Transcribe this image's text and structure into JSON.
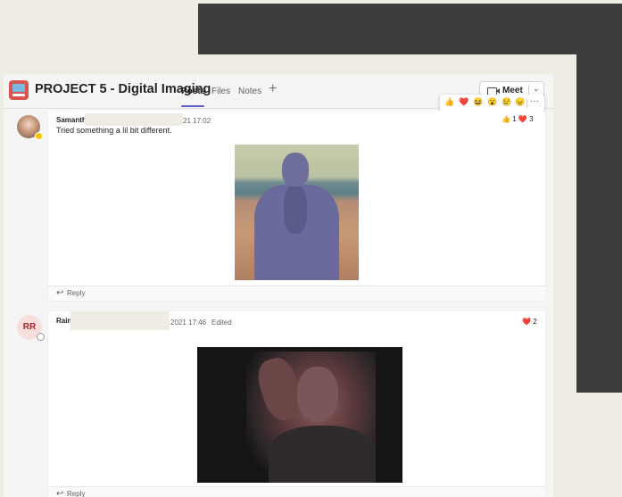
{
  "header": {
    "team_title": "PROJECT 5 - Digital Imaging",
    "tabs": [
      {
        "label": "Posts",
        "active": true
      },
      {
        "label": "Files",
        "active": false
      },
      {
        "label": "Notes",
        "active": false
      }
    ],
    "add_tab_glyph": "+",
    "meet_label": "Meet",
    "icons": [
      "team-icon",
      "video-camera-icon",
      "chevron-down-icon",
      "add-icon"
    ]
  },
  "reaction_picker": {
    "emojis": [
      "👍",
      "❤️",
      "😆",
      "😮",
      "😢",
      "😠"
    ],
    "more_glyph": "···"
  },
  "posts": [
    {
      "author_visible": "Samanth",
      "timestamp_visible": "21 17:02",
      "message": "Tried something a lil bit different.",
      "reactions": [
        {
          "emoji": "👍",
          "count": "1"
        },
        {
          "emoji": "❤️",
          "count": "3"
        }
      ],
      "reply_label": "Reply",
      "avatar_status": "away"
    },
    {
      "author_visible": "Rain",
      "avatar_initials": "RR",
      "timestamp_visible": "2021 17:46",
      "edited_label": "Edited",
      "reactions": [
        {
          "emoji": "❤️",
          "count": "2"
        }
      ],
      "reply_label": "Reply",
      "avatar_status": "offline"
    }
  ],
  "colors": {
    "accent": "#5b5fc7",
    "heart": "#c4314b",
    "like": "#f0b42a",
    "avatar_rr_bg": "#f9dede",
    "avatar_rr_text": "#a4262c"
  }
}
